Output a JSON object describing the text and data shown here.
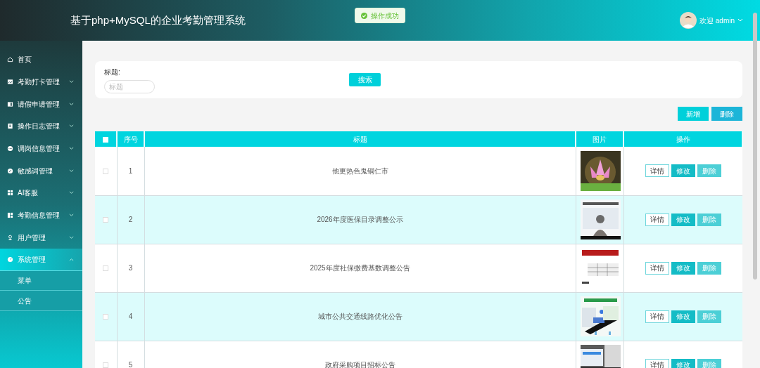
{
  "header": {
    "title": "基于php+MySQL的企业考勤管理系统",
    "user": "欢迎 admin"
  },
  "toast": {
    "text": "操作成功"
  },
  "sidebar": {
    "items": [
      {
        "label": "首页",
        "selected": false
      },
      {
        "label": "考勤打卡管理",
        "selected": false,
        "expanded": false
      },
      {
        "label": "请假申请管理",
        "selected": false,
        "expanded": false
      },
      {
        "label": "操作日志管理",
        "selected": false,
        "expanded": false
      },
      {
        "label": "调岗信息管理",
        "selected": false,
        "expanded": false
      },
      {
        "label": "敏感词管理",
        "selected": false,
        "expanded": false
      },
      {
        "label": "AI客服",
        "selected": false,
        "expanded": false
      },
      {
        "label": "考勤信息管理",
        "selected": false,
        "expanded": false
      },
      {
        "label": "用户管理",
        "selected": false,
        "expanded": false
      },
      {
        "label": "系统管理",
        "selected": true,
        "expanded": true,
        "children": [
          {
            "label": "菜单",
            "selected": false
          },
          {
            "label": "公告",
            "selected": false
          }
        ]
      }
    ]
  },
  "search": {
    "label": "标题:",
    "placeholder": "标题",
    "button": "搜索"
  },
  "toolbar": [
    "新增",
    "删除"
  ],
  "table": {
    "columns": [
      "序号",
      "标题",
      "图片",
      "操作"
    ],
    "header_checked": false,
    "rows": [
      {
        "index": "1",
        "title": "他更热色鬼铜仁市",
        "checked": false,
        "actions": [
          "详情",
          "修改",
          "删除"
        ]
      },
      {
        "index": "2",
        "title": "2026年度医保目录调整公示",
        "checked": false,
        "actions": [
          "详情",
          "修改",
          "删除"
        ]
      },
      {
        "index": "3",
        "title": "2025年度社保缴费基数调整公告",
        "checked": false,
        "actions": [
          "详情",
          "修改",
          "删除"
        ]
      },
      {
        "index": "4",
        "title": "城市公共交通线路优化公告",
        "checked": false,
        "actions": [
          "详情",
          "修改",
          "删除"
        ]
      },
      {
        "index": "5",
        "title": "政府采购项目招标公告",
        "checked": false,
        "actions": [
          "详情",
          "修改",
          "删除"
        ]
      }
    ]
  }
}
